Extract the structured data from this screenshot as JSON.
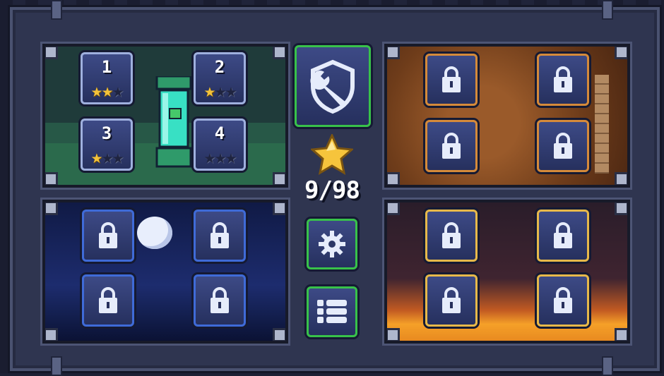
{
  "screen": "world-select",
  "total_stars": {
    "count_text": "9/98"
  },
  "buttons": {
    "upgrade": {
      "icon": "shield-wrench-icon"
    },
    "settings": {
      "icon": "gear-icon"
    },
    "level_list": {
      "icon": "list-icon"
    }
  },
  "worlds": [
    {
      "id": "lab",
      "locked": false,
      "levels": [
        {
          "number": "1",
          "stars": 2,
          "max_stars": 3
        },
        {
          "number": "2",
          "stars": 1,
          "max_stars": 3
        },
        {
          "number": "3",
          "stars": 1,
          "max_stars": 3
        },
        {
          "number": "4",
          "stars": 0,
          "max_stars": 3
        }
      ]
    },
    {
      "id": "cave",
      "locked": true,
      "levels": [
        {
          "locked": true
        },
        {
          "locked": true
        },
        {
          "locked": true
        },
        {
          "locked": true
        }
      ]
    },
    {
      "id": "night",
      "locked": true,
      "levels": [
        {
          "locked": true
        },
        {
          "locked": true
        },
        {
          "locked": true
        },
        {
          "locked": true
        }
      ]
    },
    {
      "id": "lava",
      "locked": true,
      "levels": [
        {
          "locked": true
        },
        {
          "locked": true
        },
        {
          "locked": true
        },
        {
          "locked": true
        }
      ]
    }
  ],
  "colors": {
    "star": "#f3c23a",
    "active_border": "#38c24a",
    "tile": "#2e3a70"
  }
}
